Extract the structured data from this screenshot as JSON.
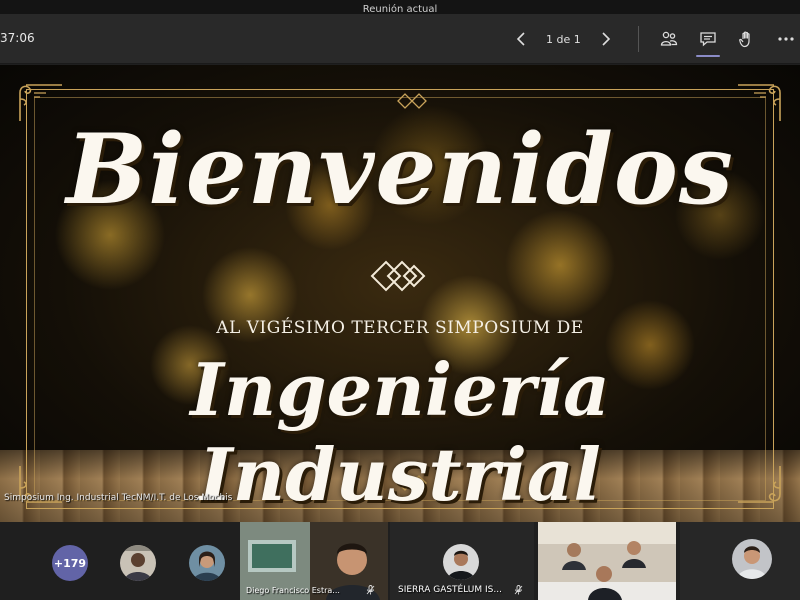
{
  "window": {
    "title": "Reunión actual"
  },
  "toolbar": {
    "timer": "37:06",
    "pager_text": "1 de 1",
    "active_tool_color": "#8b8cc7"
  },
  "slide": {
    "heading": "Bienvenidos",
    "subtitle": "AL VIGÉSIMO TERCER SIMPOSIUM DE",
    "title": "Ingeniería Industrial",
    "presenter_caption": "Simposium Ing. Industrial TecNM/I.T. de Los Mochis",
    "accent_color": "#c9a35a"
  },
  "gallery": {
    "overflow_count": "+179",
    "overflow_color": "#6264a7",
    "tiles": [
      {
        "name": "Diego Francisco Estra..."
      },
      {
        "name": "SIERRA GASTÉLUM IS..."
      }
    ]
  }
}
